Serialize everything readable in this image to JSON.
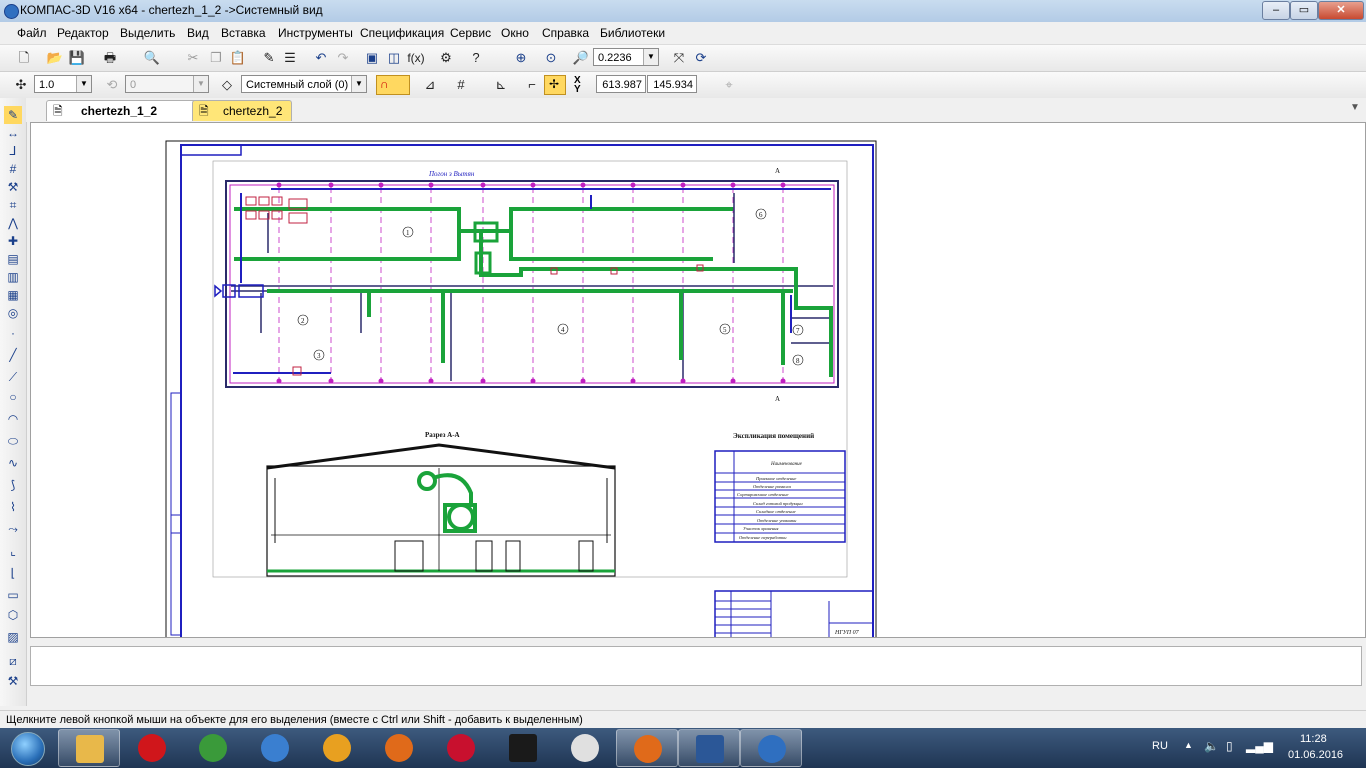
{
  "window": {
    "title": "КОМПАС-3D V16  x64 - chertezh_1_2 ->Системный вид",
    "minimize_glyph": "‒",
    "maximize_glyph": "▭",
    "close_glyph": "✕"
  },
  "menu": {
    "items": [
      "Файл",
      "Редактор",
      "Выделить",
      "Вид",
      "Вставка",
      "Инструменты",
      "Спецификация",
      "Сервис",
      "Окно",
      "Справка",
      "Библиотеки"
    ]
  },
  "toolbar1": {
    "zoom_value": "0.2236",
    "fx_label": "f(x)"
  },
  "toolbar2": {
    "step_value": "1.0",
    "angle_value": "0",
    "layer_value": "Системный слой (0)",
    "coord_x": "613.987",
    "coord_y": "145.934",
    "x_label": "X",
    "y_label": "Y"
  },
  "tabs": [
    {
      "label": "chertezh_1_2",
      "active": true
    },
    {
      "label": "chertezh_2",
      "active": false
    }
  ],
  "drawing": {
    "plan_title": "Погон з Вытян",
    "section_title": "Разрез А-А",
    "spec_title": "Экспликация помещений",
    "room_numbers": [
      "1",
      "2",
      "3",
      "4",
      "5",
      "6",
      "7",
      "8"
    ],
    "spec_header": "Наименование",
    "spec_rows": [
      "Приемное отделение",
      "Отделение размола",
      "Сортировочное отделение",
      "Склад готовой продукции",
      "Складное отделение",
      "Отделение упаковки",
      "Участок хранения",
      "Отделение переработки"
    ],
    "stamp_code": "НГУП 07"
  },
  "status": {
    "message": "Щелкните левой кнопкой мыши на объекте для его выделения (вместе с Ctrl или Shift - добавить к выделенным)"
  },
  "taskbar": {
    "lang": "RU",
    "time": "11:28",
    "date": "01.06.2016",
    "apps": [
      {
        "name": "explorer",
        "color": "#e8b84a"
      },
      {
        "name": "opera",
        "color": "#d0161b"
      },
      {
        "name": "chrome",
        "color": "#3a9a3a"
      },
      {
        "name": "safari",
        "color": "#3a7fd0"
      },
      {
        "name": "keys",
        "color": "#e8a020"
      },
      {
        "name": "firefox",
        "color": "#e06a1a"
      },
      {
        "name": "pokerstars",
        "color": "#c8102e"
      },
      {
        "name": "fulltilt",
        "color": "#1a1a1a"
      },
      {
        "name": "yandex",
        "color": "#e0e0e0"
      },
      {
        "name": "firefox-2",
        "color": "#e06a1a"
      },
      {
        "name": "word",
        "color": "#2b5797"
      },
      {
        "name": "kompas",
        "color": "#2f6fc0"
      }
    ]
  },
  "colors": {
    "frame": "#1f1fbf",
    "duct": "#1aa33a",
    "axis": "#c020c0",
    "wall": "#2a2a6a"
  }
}
